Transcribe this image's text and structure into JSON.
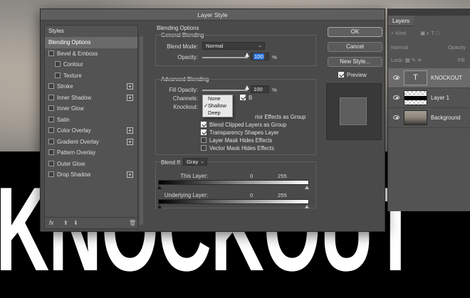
{
  "canvas": {
    "big_text": "KNOCKOUT"
  },
  "dialog": {
    "title": "Layer Style",
    "styles_header": "Styles",
    "styles": [
      {
        "label": "Blending Options",
        "selected": true,
        "checkbox": false,
        "plus": false,
        "indent": false
      },
      {
        "label": "Bevel & Emboss",
        "checkbox": true,
        "checked": false,
        "plus": false,
        "indent": false
      },
      {
        "label": "Contour",
        "checkbox": true,
        "checked": false,
        "plus": false,
        "indent": true
      },
      {
        "label": "Texture",
        "checkbox": true,
        "checked": false,
        "plus": false,
        "indent": true
      },
      {
        "label": "Stroke",
        "checkbox": true,
        "checked": false,
        "plus": true,
        "indent": false
      },
      {
        "label": "Inner Shadow",
        "checkbox": true,
        "checked": false,
        "plus": true,
        "indent": false
      },
      {
        "label": "Inner Glow",
        "checkbox": true,
        "checked": false,
        "plus": false,
        "indent": false
      },
      {
        "label": "Satin",
        "checkbox": true,
        "checked": false,
        "plus": false,
        "indent": false
      },
      {
        "label": "Color Overlay",
        "checkbox": true,
        "checked": false,
        "plus": true,
        "indent": false
      },
      {
        "label": "Gradient Overlay",
        "checkbox": true,
        "checked": false,
        "plus": true,
        "indent": false
      },
      {
        "label": "Pattern Overlay",
        "checkbox": true,
        "checked": false,
        "plus": false,
        "indent": false
      },
      {
        "label": "Outer Glow",
        "checkbox": true,
        "checked": false,
        "plus": false,
        "indent": false
      },
      {
        "label": "Drop Shadow",
        "checkbox": true,
        "checked": false,
        "plus": true,
        "indent": false
      }
    ],
    "footer_fx": "fx",
    "blending": {
      "title": "Blending Options",
      "general_title": "General Blending",
      "blend_mode_label": "Blend Mode:",
      "blend_mode_value": "Normal",
      "opacity_label": "Opacity:",
      "opacity_value": "100",
      "percent": "%",
      "advanced_title": "Advanced Blending",
      "fill_opacity_label": "Fill Opacity:",
      "fill_opacity_value": "100",
      "channels_label": "Channels:",
      "channel_b": "B",
      "knockout_label": "Knockout:",
      "knockout_options": [
        "None",
        "Shallow",
        "Deep"
      ],
      "knockout_selected": "Shallow",
      "checks": [
        {
          "label": "Blend Interior Effects as Group",
          "visible_text": "rior Effects as Group",
          "checked": false
        },
        {
          "label": "Blend Clipped Layers as Group",
          "visible_text": "Blend Clipped Layers as Group",
          "checked": true
        },
        {
          "label": "Transparency Shapes Layer",
          "visible_text": "Transparency Shapes Layer",
          "checked": true
        },
        {
          "label": "Layer Mask Hides Effects",
          "visible_text": "Layer Mask Hides Effects",
          "checked": false
        },
        {
          "label": "Vector Mask Hides Effects",
          "visible_text": "Vector Mask Hides Effects",
          "checked": false
        }
      ],
      "blend_if_label": "Blend If:",
      "blend_if_value": "Gray",
      "this_layer_label": "This Layer:",
      "this_layer_min": "0",
      "this_layer_max": "255",
      "underlying_label": "Underlying Layer:",
      "underlying_min": "0",
      "underlying_max": "255"
    },
    "buttons": {
      "ok": "OK",
      "cancel": "Cancel",
      "new_style": "New Style..."
    },
    "preview_label": "Preview",
    "preview_checked": true
  },
  "layers": {
    "tab": "Layers",
    "filter_kind": "Kind",
    "blend_mode": "Normal",
    "opacity_label": "Opacity",
    "lock_label": "Lock:",
    "fill_label": "Fill",
    "items": [
      {
        "name": "KNOCKOUT",
        "type": "text",
        "selected": true,
        "thumb_glyph": "T"
      },
      {
        "name": "Layer 1",
        "type": "pixel",
        "selected": false
      },
      {
        "name": "Background",
        "type": "photo",
        "selected": false
      }
    ]
  }
}
